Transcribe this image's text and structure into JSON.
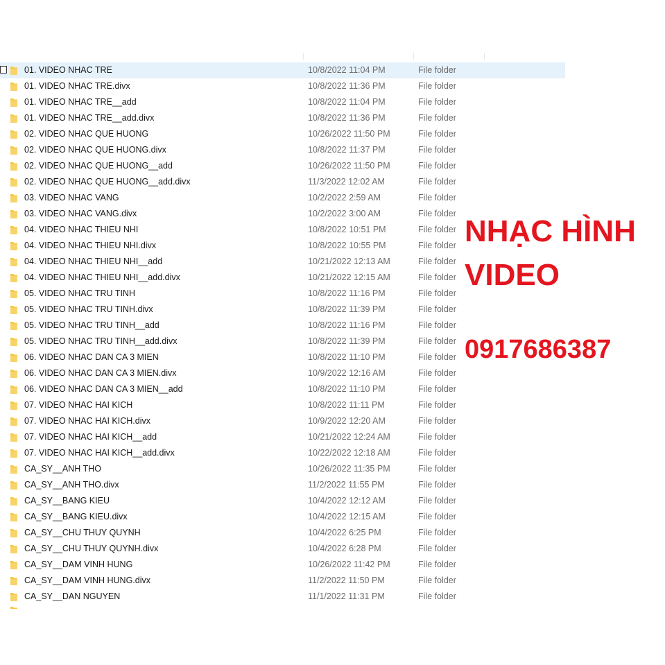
{
  "colors": {
    "selected_row_bg": "#e5f1fb",
    "folder_yellow": "#f5c842",
    "overlay_red": "#e4151f",
    "secondary_text": "#6d6d6d"
  },
  "overlay": {
    "title": "NHẠC HÌNH",
    "subtitle": "VIDEO",
    "phone": "0917686387"
  },
  "files": [
    {
      "name": "01. VIDEO NHAC TRE",
      "date": "10/8/2022 11:04 PM",
      "type": "File folder",
      "selected": true
    },
    {
      "name": "01. VIDEO NHAC TRE.divx",
      "date": "10/8/2022 11:36 PM",
      "type": "File folder"
    },
    {
      "name": "01. VIDEO NHAC TRE__add",
      "date": "10/8/2022 11:04 PM",
      "type": "File folder"
    },
    {
      "name": "01. VIDEO NHAC TRE__add.divx",
      "date": "10/8/2022 11:36 PM",
      "type": "File folder"
    },
    {
      "name": "02. VIDEO NHAC QUE HUONG",
      "date": "10/26/2022 11:50 PM",
      "type": "File folder"
    },
    {
      "name": "02. VIDEO NHAC QUE HUONG.divx",
      "date": "10/8/2022 11:37 PM",
      "type": "File folder"
    },
    {
      "name": "02. VIDEO NHAC QUE HUONG__add",
      "date": "10/26/2022 11:50 PM",
      "type": "File folder"
    },
    {
      "name": "02. VIDEO NHAC QUE HUONG__add.divx",
      "date": "11/3/2022 12:02 AM",
      "type": "File folder"
    },
    {
      "name": "03. VIDEO NHAC VANG",
      "date": "10/2/2022 2:59 AM",
      "type": "File folder"
    },
    {
      "name": "03. VIDEO NHAC VANG.divx",
      "date": "10/2/2022 3:00 AM",
      "type": "File folder"
    },
    {
      "name": "04. VIDEO NHAC THIEU NHI",
      "date": "10/8/2022 10:51 PM",
      "type": "File folder"
    },
    {
      "name": "04. VIDEO NHAC THIEU NHI.divx",
      "date": "10/8/2022 10:55 PM",
      "type": "File folder"
    },
    {
      "name": "04. VIDEO NHAC THIEU NHI__add",
      "date": "10/21/2022 12:13 AM",
      "type": "File folder"
    },
    {
      "name": "04. VIDEO NHAC THIEU NHI__add.divx",
      "date": "10/21/2022 12:15 AM",
      "type": "File folder"
    },
    {
      "name": "05. VIDEO NHAC TRU TINH",
      "date": "10/8/2022 11:16 PM",
      "type": "File folder"
    },
    {
      "name": "05. VIDEO NHAC TRU TINH.divx",
      "date": "10/8/2022 11:39 PM",
      "type": "File folder"
    },
    {
      "name": "05. VIDEO NHAC TRU TINH__add",
      "date": "10/8/2022 11:16 PM",
      "type": "File folder"
    },
    {
      "name": "05. VIDEO NHAC TRU TINH__add.divx",
      "date": "10/8/2022 11:39 PM",
      "type": "File folder"
    },
    {
      "name": "06. VIDEO NHAC DAN CA 3 MIEN",
      "date": "10/8/2022 11:10 PM",
      "type": "File folder"
    },
    {
      "name": "06. VIDEO NHAC DAN CA 3 MIEN.divx",
      "date": "10/9/2022 12:16 AM",
      "type": "File folder"
    },
    {
      "name": "06. VIDEO NHAC DAN CA 3 MIEN__add",
      "date": "10/8/2022 11:10 PM",
      "type": "File folder"
    },
    {
      "name": "07. VIDEO NHAC HAI KICH",
      "date": "10/8/2022 11:11 PM",
      "type": "File folder"
    },
    {
      "name": "07. VIDEO NHAC HAI KICH.divx",
      "date": "10/9/2022 12:20 AM",
      "type": "File folder"
    },
    {
      "name": "07. VIDEO NHAC HAI KICH__add",
      "date": "10/21/2022 12:24 AM",
      "type": "File folder"
    },
    {
      "name": "07. VIDEO NHAC HAI KICH__add.divx",
      "date": "10/22/2022 12:18 AM",
      "type": "File folder"
    },
    {
      "name": "CA_SY__ANH THO",
      "date": "10/26/2022 11:35 PM",
      "type": "File folder"
    },
    {
      "name": "CA_SY__ANH THO.divx",
      "date": "11/2/2022 11:55 PM",
      "type": "File folder"
    },
    {
      "name": "CA_SY__BANG KIEU",
      "date": "10/4/2022 12:12 AM",
      "type": "File folder"
    },
    {
      "name": "CA_SY__BANG KIEU.divx",
      "date": "10/4/2022 12:15 AM",
      "type": "File folder"
    },
    {
      "name": "CA_SY__CHU THUY QUYNH",
      "date": "10/4/2022 6:25 PM",
      "type": "File folder"
    },
    {
      "name": "CA_SY__CHU THUY QUYNH.divx",
      "date": "10/4/2022 6:28 PM",
      "type": "File folder"
    },
    {
      "name": "CA_SY__DAM VINH HUNG",
      "date": "10/26/2022 11:42 PM",
      "type": "File folder"
    },
    {
      "name": "CA_SY__DAM VINH HUNG.divx",
      "date": "11/2/2022 11:50 PM",
      "type": "File folder"
    },
    {
      "name": "CA_SY__DAN NGUYEN",
      "date": "11/1/2022 11:31 PM",
      "type": "File folder"
    }
  ]
}
